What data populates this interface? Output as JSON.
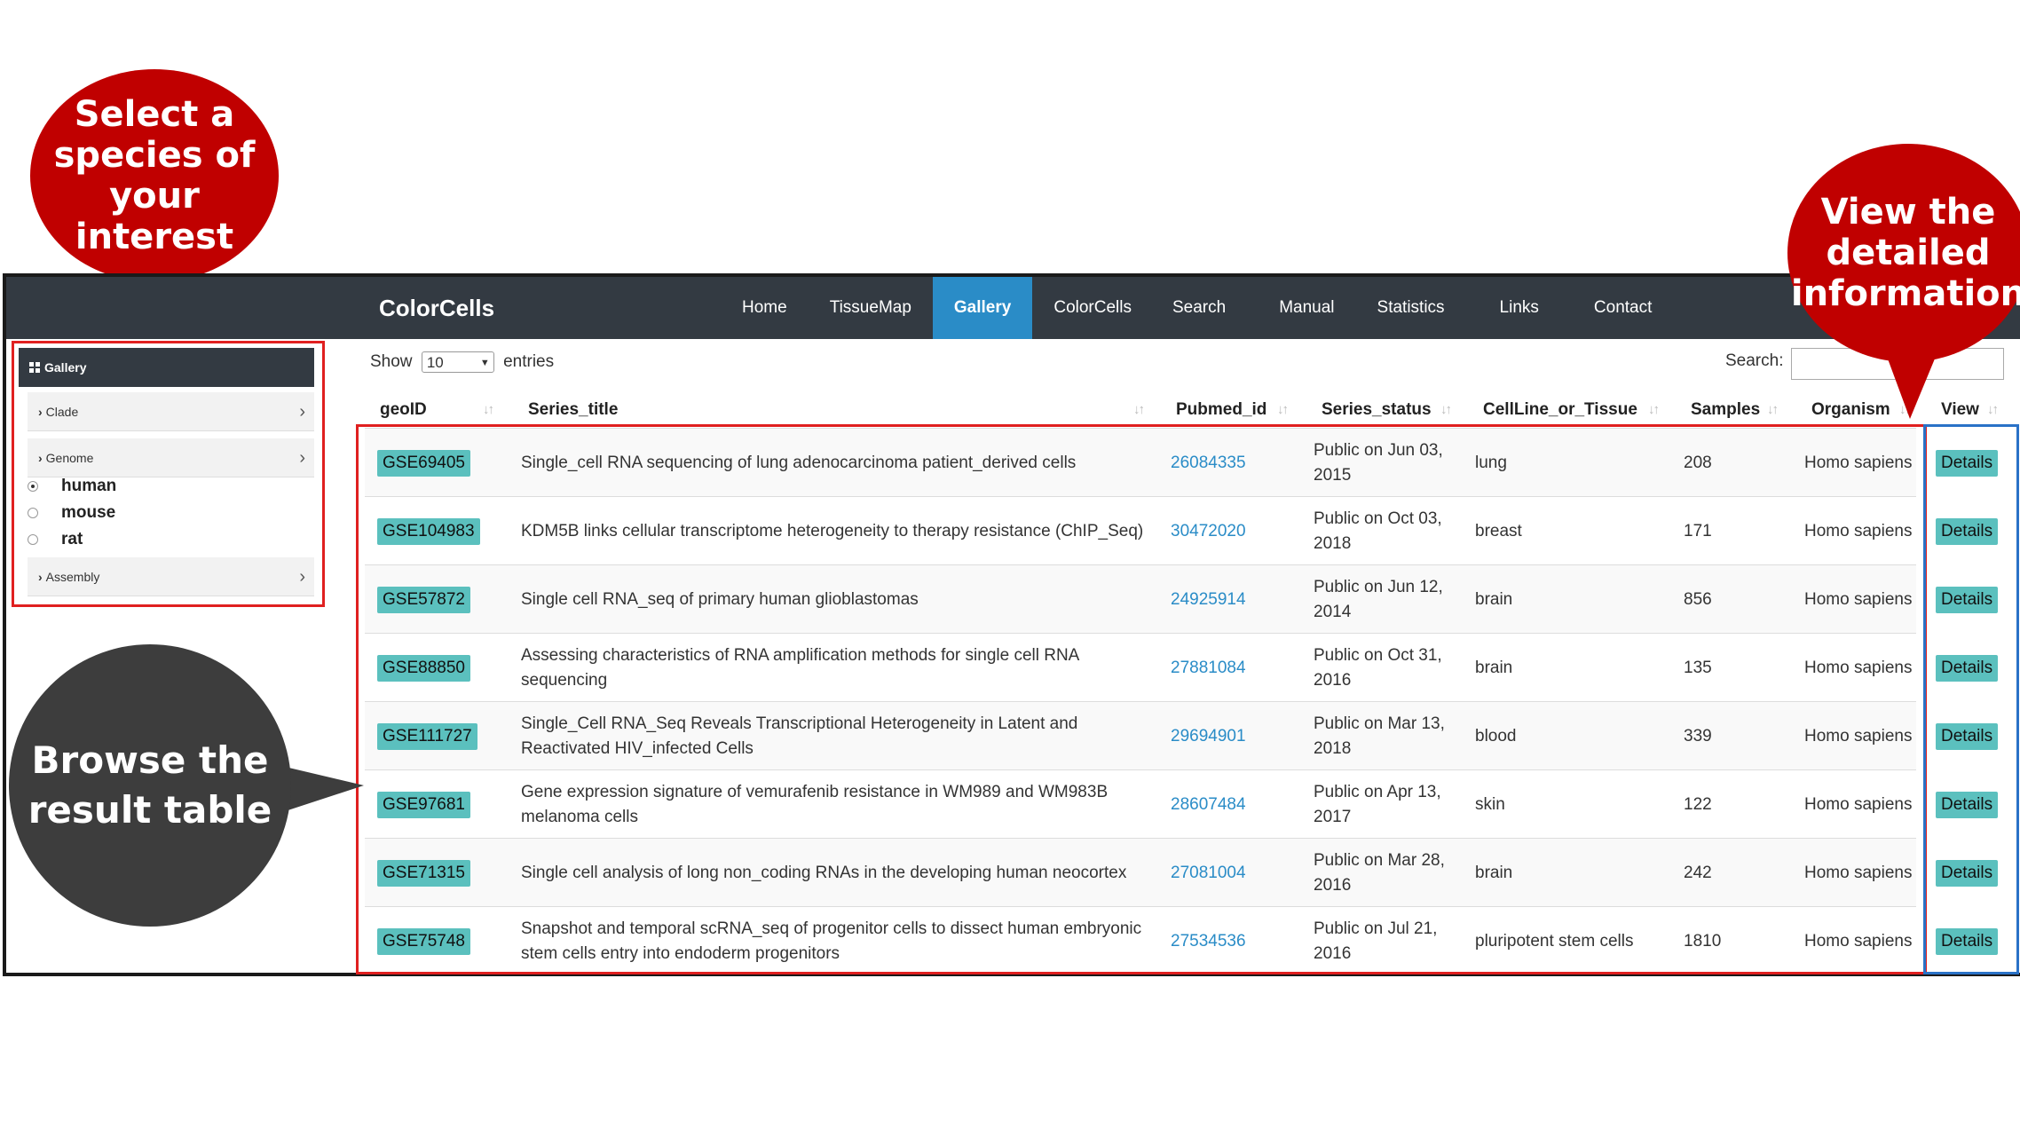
{
  "callouts": {
    "species": "Select a\nspecies of\nyour interest",
    "details": "View the\ndetailed\ninformation",
    "browse": "Browse the\nresult table"
  },
  "navbar": {
    "brand": "ColorCells",
    "items": [
      {
        "label": "Home",
        "active": false
      },
      {
        "label": "TissueMap",
        "active": false
      },
      {
        "label": "Gallery",
        "active": true
      },
      {
        "label": "ColorCells",
        "active": false
      },
      {
        "label": "Search",
        "active": false
      },
      {
        "label": "Manual",
        "active": false
      },
      {
        "label": "Statistics",
        "active": false
      },
      {
        "label": "Links",
        "active": false
      },
      {
        "label": "Contact",
        "active": false
      }
    ]
  },
  "sidebar": {
    "title": "Gallery",
    "clade": "Clade",
    "genome": "Genome",
    "species": [
      {
        "label": "human",
        "selected": true
      },
      {
        "label": "mouse",
        "selected": false
      },
      {
        "label": "rat",
        "selected": false
      }
    ],
    "assembly": "Assembly"
  },
  "table_controls": {
    "show_label": "Show",
    "show_value": "10",
    "entries_label": "entries",
    "search_label": "Search:"
  },
  "table": {
    "headers": [
      "geoID",
      "Series_title",
      "Pubmed_id",
      "Series_status",
      "CellLine_or_Tissue",
      "Samples",
      "Organism",
      "View"
    ],
    "rows": [
      {
        "geoid": "GSE69405",
        "title": "Single_cell RNA sequencing of lung adenocarcinoma patient_derived cells",
        "pubmed": "26084335",
        "status": "Public on Jun 03, 2015",
        "tissue": "lung",
        "samples": "208",
        "organism": "Homo sapiens",
        "view": "Details"
      },
      {
        "geoid": "GSE104983",
        "title": "KDM5B links cellular transcriptome heterogeneity to therapy resistance (ChIP_Seq)",
        "pubmed": "30472020",
        "status": "Public on Oct 03, 2018",
        "tissue": "breast",
        "samples": "171",
        "organism": "Homo sapiens",
        "view": "Details"
      },
      {
        "geoid": "GSE57872",
        "title": "Single cell RNA_seq of primary human glioblastomas",
        "pubmed": "24925914",
        "status": "Public on Jun 12, 2014",
        "tissue": "brain",
        "samples": "856",
        "organism": "Homo sapiens",
        "view": "Details"
      },
      {
        "geoid": "GSE88850",
        "title": "Assessing characteristics of RNA amplification methods for single cell RNA sequencing",
        "pubmed": "27881084",
        "status": "Public on Oct 31, 2016",
        "tissue": "brain",
        "samples": "135",
        "organism": "Homo sapiens",
        "view": "Details"
      },
      {
        "geoid": "GSE111727",
        "title": "Single_Cell RNA_Seq Reveals Transcriptional Heterogeneity in Latent and Reactivated HIV_infected Cells",
        "pubmed": "29694901",
        "status": "Public on Mar 13, 2018",
        "tissue": "blood",
        "samples": "339",
        "organism": "Homo sapiens",
        "view": "Details"
      },
      {
        "geoid": "GSE97681",
        "title": "Gene expression signature of vemurafenib resistance in WM989 and WM983B melanoma cells",
        "pubmed": "28607484",
        "status": "Public on Apr 13, 2017",
        "tissue": "skin",
        "samples": "122",
        "organism": "Homo sapiens",
        "view": "Details"
      },
      {
        "geoid": "GSE71315",
        "title": "Single cell analysis of long non_coding RNAs in the developing human neocortex",
        "pubmed": "27081004",
        "status": "Public on Mar 28, 2016",
        "tissue": "brain",
        "samples": "242",
        "organism": "Homo sapiens",
        "view": "Details"
      },
      {
        "geoid": "GSE75748",
        "title": "Snapshot and temporal scRNA_seq of progenitor cells to dissect human embryonic stem cells entry into endoderm progenitors",
        "pubmed": "27534536",
        "status": "Public on Jul 21, 2016",
        "tissue": "pluripotent stem cells",
        "samples": "1810",
        "organism": "Homo sapiens",
        "view": "Details"
      }
    ]
  },
  "colors": {
    "navbar_bg": "#333a42",
    "active_tab": "#2a8cc7",
    "badge": "#5bc0be",
    "callout_red": "#c00000",
    "callout_dark": "#3d3d3d",
    "highlight_red": "#e02020",
    "highlight_blue": "#2a72c7"
  },
  "icons": {
    "gallery": "grid-icon",
    "expand": "chevron-right-icon",
    "sort": "sort-icon",
    "select": "dropdown-arrow-icon"
  }
}
